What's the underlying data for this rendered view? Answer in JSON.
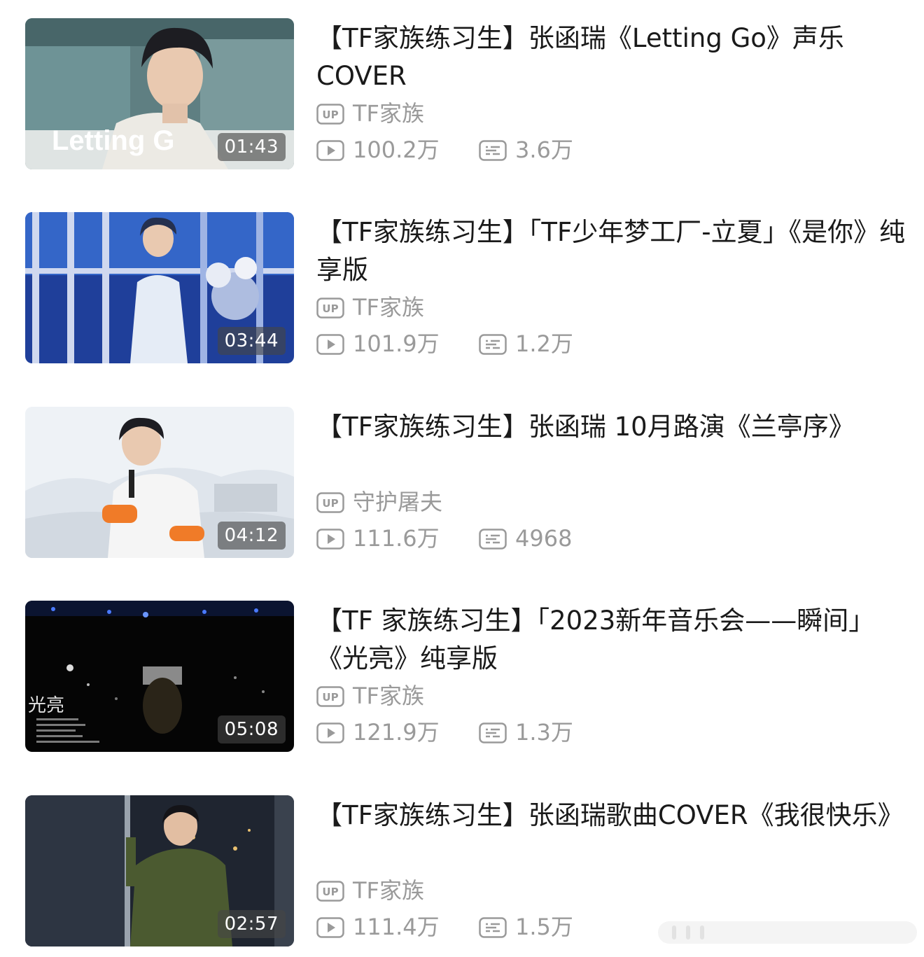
{
  "videos": [
    {
      "title": "【TF家族练习生】张函瑞《Letting Go》声乐COVER",
      "duration": "01:43",
      "uploader": "TF家族",
      "plays": "100.2万",
      "comments": "3.6万",
      "thumbnail_overlay_text": "Letting G"
    },
    {
      "title": "【TF家族练习生】「TF少年梦工厂-立夏」《是你》纯享版",
      "duration": "03:44",
      "uploader": "TF家族",
      "plays": "101.9万",
      "comments": "1.2万"
    },
    {
      "title": "【TF家族练习生】张函瑞 10月路演《兰亭序》",
      "duration": "04:12",
      "uploader": "守护屠夫",
      "plays": "111.6万",
      "comments": "4968"
    },
    {
      "title": "【TF 家族练习生】「2023新年音乐会——瞬间」《光亮》纯享版",
      "duration": "05:08",
      "uploader": "TF家族",
      "plays": "121.9万",
      "comments": "1.3万",
      "thumbnail_overlay_text": "光亮"
    },
    {
      "title": "【TF家族练习生】张函瑞歌曲COVER《我很快乐》",
      "duration": "02:57",
      "uploader": "TF家族",
      "plays": "111.4万",
      "comments": "1.5万"
    }
  ],
  "icons": {
    "uploader": "up-badge-icon",
    "plays": "play-count-icon",
    "comments": "danmaku-icon"
  },
  "colors": {
    "meta_text": "#9a9a9a",
    "title_text": "#1a1a1a"
  }
}
